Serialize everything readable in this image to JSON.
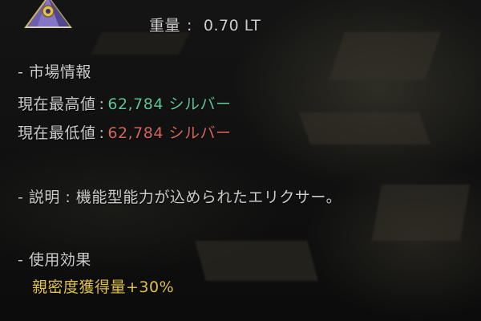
{
  "item": {
    "icon": "elixir-pyramid-icon",
    "weight_label": "重量",
    "weight_colon": ":",
    "weight_value": "0.70 LT"
  },
  "market": {
    "header": "- 市場情報",
    "highest_label": "現在最高値",
    "highest_value": "62,784 シルバー",
    "lowest_label": "現在最低値",
    "lowest_value": "62,784 シルバー",
    "colon": ":"
  },
  "description": {
    "text": "- 説明 : 機能型能力が込められたエリクサー。"
  },
  "effects": {
    "header": "- 使用効果",
    "items": [
      "親密度獲得量+30%"
    ]
  },
  "colors": {
    "highest": "#5fc49a",
    "lowest": "#d3675e",
    "effect": "#e0c24c"
  }
}
